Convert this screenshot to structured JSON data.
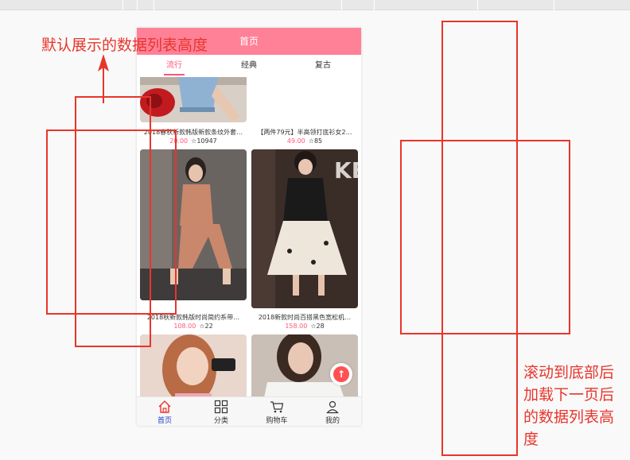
{
  "navbar": {
    "title": "首页"
  },
  "tabs": [
    {
      "label": "流行",
      "active": true
    },
    {
      "label": "经典",
      "active": false
    },
    {
      "label": "复古",
      "active": false
    }
  ],
  "products": [
    {
      "title": "2018春秋新款韩版新款条纹外套…",
      "price": "20.00",
      "fav": "10947"
    },
    {
      "title": "【两件79元】半高领打底衫女2…",
      "price": "49.00",
      "fav": "85"
    },
    {
      "title": "2018秋新款韩版时尚简约系带…",
      "price": "108.00",
      "fav": "22"
    },
    {
      "title": "2018新款时尚百搭黑色宽松机…",
      "price": "158.00",
      "fav": "28"
    }
  ],
  "tabbar": [
    {
      "label": "首页",
      "icon": "home-icon",
      "active": true
    },
    {
      "label": "分类",
      "icon": "category-icon",
      "active": false
    },
    {
      "label": "购物车",
      "icon": "cart-icon",
      "active": false
    },
    {
      "label": "我的",
      "icon": "profile-icon",
      "active": false
    }
  ],
  "back_top": {
    "symbol": "↑"
  },
  "annotations": {
    "left_label": "默认展示的数据列表高度",
    "right_label": "滚动到底部后加载下一页后的数据列表高度"
  },
  "colors": {
    "navbar": "#ff8198",
    "accent": "#ff5777",
    "annotation": "#e8352c",
    "tab_active": "#1c41c9"
  }
}
